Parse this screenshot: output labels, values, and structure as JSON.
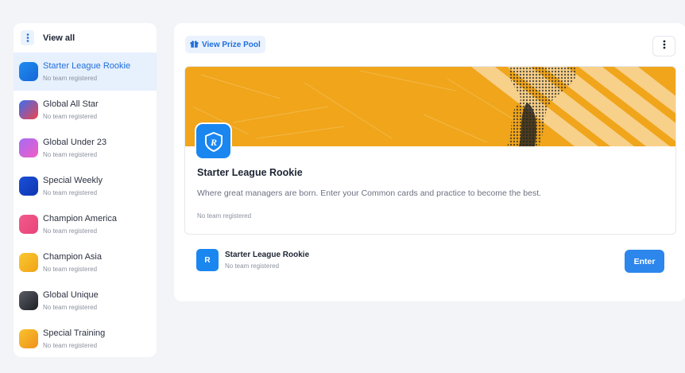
{
  "sidebar": {
    "view_all_label": "View all",
    "items": [
      {
        "label": "Starter League Rookie",
        "sub": "No team registered",
        "color_a": "#1f8cf0",
        "color_b": "#1566d6"
      },
      {
        "label": "Global All Star",
        "sub": "No team registered",
        "color_a": "#3a6ff2",
        "color_b": "#f0434b"
      },
      {
        "label": "Global Under 23",
        "sub": "No team registered",
        "color_a": "#a46cf5",
        "color_b": "#f35cc4"
      },
      {
        "label": "Special Weekly",
        "sub": "No team registered",
        "color_a": "#1a4fd8",
        "color_b": "#0f36b0"
      },
      {
        "label": "Champion America",
        "sub": "No team registered",
        "color_a": "#f25b8a",
        "color_b": "#e8437b"
      },
      {
        "label": "Champion Asia",
        "sub": "No team registered",
        "color_a": "#f8c92e",
        "color_b": "#f2a21a"
      },
      {
        "label": "Global Unique",
        "sub": "No team registered",
        "color_a": "#5a5d66",
        "color_b": "#1d1f24"
      },
      {
        "label": "Special Training",
        "sub": "No team registered",
        "color_a": "#f7c32c",
        "color_b": "#f0901c"
      }
    ]
  },
  "main": {
    "prize_pool_label": "View Prize Pool",
    "card": {
      "title": "Starter League Rookie",
      "description": "Where great managers are born. Enter your Common cards and practice to become the best.",
      "sub": "No team registered",
      "badge_letter": "R"
    },
    "entry": {
      "badge_letter": "R",
      "name": "Starter League Rookie",
      "sub": "No team registered",
      "enter_label": "Enter"
    }
  },
  "colors": {
    "accent": "#1f6fdb",
    "active_bg": "#e7f0fd",
    "banner": "#f0a51b",
    "enter_button": "#2c86ec"
  }
}
